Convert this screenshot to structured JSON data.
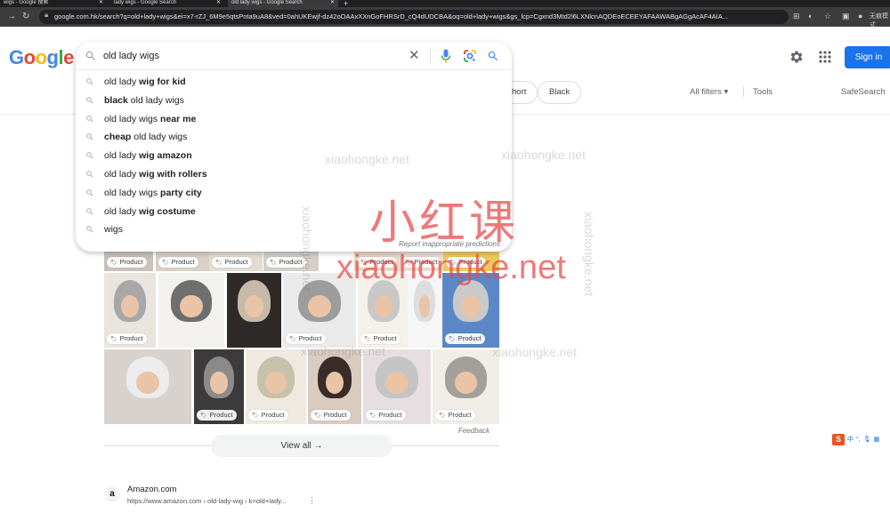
{
  "browser": {
    "tabs": [
      {
        "label": "wigs - Google 搜索",
        "active": false
      },
      {
        "label": "lady wigs - Google Search",
        "active": false
      },
      {
        "label": "old lady wigs - Google Search",
        "active": true
      }
    ],
    "address": "google.com.hk/search?q=old+lady+wigs&ei=x7-rZJ_6M9e5qtsPnta9uA8&ved=0ahUKEwjf-dz42oOAAxXXnGoFHRSrD_cQ4dUDCBA&oq=old+lady+wigs&gs_lcp=Cgxnd3Mtd2l6LXNlcnAQDEoECEEYAFAAWABgAGgAcAF4AIA...",
    "profile_label": "无痕模式"
  },
  "header": {
    "logo_letters": [
      {
        "ch": "G",
        "color": "#4285F4"
      },
      {
        "ch": "o",
        "color": "#EA4335"
      },
      {
        "ch": "o",
        "color": "#FBBC05"
      },
      {
        "ch": "g",
        "color": "#4285F4"
      },
      {
        "ch": "l",
        "color": "#34A853"
      },
      {
        "ch": "e",
        "color": "#EA4335"
      }
    ],
    "signin_label": "Sign in"
  },
  "search": {
    "query": "old lady wigs",
    "suggestions": [
      {
        "pre": "old lady ",
        "bold": "wig for kid",
        "post": ""
      },
      {
        "pre": "",
        "bold": "black",
        "post": " old lady wigs"
      },
      {
        "pre": "old lady wigs ",
        "bold": "near me",
        "post": ""
      },
      {
        "pre": "",
        "bold": "cheap",
        "post": " old lady wigs"
      },
      {
        "pre": "old lady ",
        "bold": "wig amazon",
        "post": ""
      },
      {
        "pre": "old lady ",
        "bold": "wig with rollers",
        "post": ""
      },
      {
        "pre": "old lady wigs ",
        "bold": "party city",
        "post": ""
      },
      {
        "pre": "old lady ",
        "bold": "wig costume",
        "post": ""
      },
      {
        "pre": "wigs",
        "bold": "",
        "post": ""
      }
    ],
    "report_label": "Report inappropriate predictions"
  },
  "filters": {
    "chip_partial": "hort",
    "chip_black": "Black",
    "all_filters": "All filters",
    "tools": "Tools",
    "safesearch": "SafeSearch"
  },
  "images": {
    "badge_label": "Product",
    "feedback": "Feedback",
    "view_all": "View all"
  },
  "result": {
    "favicon": "a",
    "site": "Amazon.com",
    "url": "https://www.amazon.com › old-lady-wig › k=old+lady..."
  },
  "watermark": {
    "text": "xiaohongke.net",
    "big_cn": "小红课",
    "big_en": "xiaohongke.net"
  },
  "ime": {
    "label": "中"
  }
}
